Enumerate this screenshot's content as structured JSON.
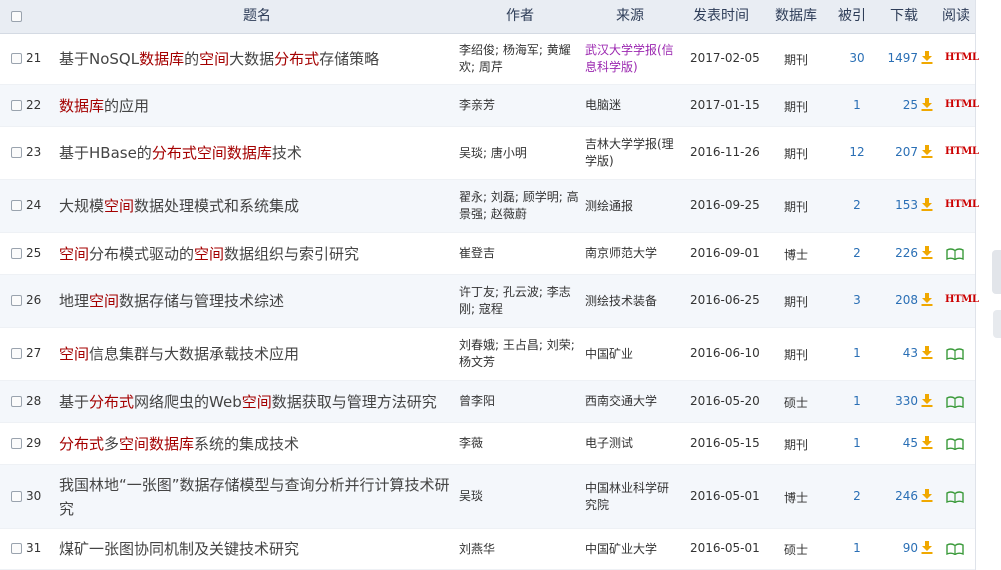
{
  "header": {
    "title": "题名",
    "author": "作者",
    "source": "来源",
    "date": "发表时间",
    "database": "数据库",
    "cited": "被引",
    "downloads": "下载",
    "read": "阅读"
  },
  "rows": [
    {
      "num": "21",
      "title": [
        [
          "基于NoSQL",
          0
        ],
        [
          "数据库",
          1
        ],
        [
          "的",
          0
        ],
        [
          "空间",
          1
        ],
        [
          "大数据",
          0
        ],
        [
          "分布式",
          1
        ],
        [
          "存储策略",
          0
        ]
      ],
      "author": "李绍俊; 杨海军; 黄耀欢; 周芹",
      "source": "武汉大学学报(信息科学版)",
      "source_color": "purple",
      "date": "2017-02-05",
      "db": "期刊",
      "cited": "30",
      "downloads": "1497",
      "read": "html"
    },
    {
      "num": "22",
      "title": [
        [
          "数据库",
          1
        ],
        [
          "的应用",
          0
        ]
      ],
      "author": "李亲芳",
      "source": "电脑迷",
      "source_color": "",
      "date": "2017-01-15",
      "db": "期刊",
      "cited": "1",
      "downloads": "25",
      "read": "html"
    },
    {
      "num": "23",
      "title": [
        [
          "基于HBase的",
          0
        ],
        [
          "分布式空间数据库",
          1
        ],
        [
          "技术",
          0
        ]
      ],
      "author": "吴琰; 唐小明",
      "source": "吉林大学学报(理学版)",
      "source_color": "",
      "date": "2016-11-26",
      "db": "期刊",
      "cited": "12",
      "downloads": "207",
      "read": "html"
    },
    {
      "num": "24",
      "title": [
        [
          "大规模",
          0
        ],
        [
          "空间",
          1
        ],
        [
          "数据处理模式和系统集成",
          0
        ]
      ],
      "author": "翟永; 刘磊; 顾学明; 高景强; 赵薇蔚",
      "source": "测绘通报",
      "source_color": "",
      "date": "2016-09-25",
      "db": "期刊",
      "cited": "2",
      "downloads": "153",
      "read": "html"
    },
    {
      "num": "25",
      "title": [
        [
          "空间",
          1
        ],
        [
          "分布模式驱动的",
          0
        ],
        [
          "空间",
          1
        ],
        [
          "数据组织与索引研究",
          0
        ]
      ],
      "author": "崔登吉",
      "source": "南京师范大学",
      "source_color": "",
      "date": "2016-09-01",
      "db": "博士",
      "cited": "2",
      "downloads": "226",
      "read": "book"
    },
    {
      "num": "26",
      "title": [
        [
          "地理",
          0
        ],
        [
          "空间",
          1
        ],
        [
          "数据存储与管理技术综述",
          0
        ]
      ],
      "author": "许丁友; 孔云波; 李志刚; 寇程",
      "source": "测绘技术装备",
      "source_color": "",
      "date": "2016-06-25",
      "db": "期刊",
      "cited": "3",
      "downloads": "208",
      "read": "html"
    },
    {
      "num": "27",
      "title": [
        [
          "空间",
          1
        ],
        [
          "信息集群与大数据承载技术应用",
          0
        ]
      ],
      "author": "刘春娥; 王占昌; 刘荣; 杨文芳",
      "source": "中国矿业",
      "source_color": "",
      "date": "2016-06-10",
      "db": "期刊",
      "cited": "1",
      "downloads": "43",
      "read": "book"
    },
    {
      "num": "28",
      "title": [
        [
          "基于",
          0
        ],
        [
          "分布式",
          1
        ],
        [
          "网络爬虫的Web",
          0
        ],
        [
          "空间",
          1
        ],
        [
          "数据获取与管理方法研究",
          0
        ]
      ],
      "author": "曾李阳",
      "source": "西南交通大学",
      "source_color": "",
      "date": "2016-05-20",
      "db": "硕士",
      "cited": "1",
      "downloads": "330",
      "read": "book"
    },
    {
      "num": "29",
      "title": [
        [
          "分布式",
          1
        ],
        [
          "多",
          0
        ],
        [
          "空间数据库",
          1
        ],
        [
          "系统的集成技术",
          0
        ]
      ],
      "author": "李薇",
      "source": "电子测试",
      "source_color": "",
      "date": "2016-05-15",
      "db": "期刊",
      "cited": "1",
      "downloads": "45",
      "read": "book"
    },
    {
      "num": "30",
      "title": [
        [
          "我国林地“一张图”数据存储模型与查询分析并行计算技术研究",
          0
        ]
      ],
      "author": "吴琰",
      "source": "中国林业科学研究院",
      "source_color": "",
      "date": "2016-05-01",
      "db": "博士",
      "cited": "2",
      "downloads": "246",
      "read": "book"
    },
    {
      "num": "31",
      "title": [
        [
          "煤矿一张图协同机制及关键技术研究",
          0
        ]
      ],
      "author": "刘燕华",
      "source": "中国矿业大学",
      "source_color": "",
      "date": "2016-05-01",
      "db": "硕士",
      "cited": "1",
      "downloads": "90",
      "read": "book"
    }
  ],
  "icons": {
    "download": "download-icon",
    "html": "html-icon",
    "read": "book-read-icon"
  },
  "html_label": "HTML",
  "colors": {
    "highlight": "#a40000",
    "link": "#2a6fb5",
    "html_red": "#cc0000",
    "source_purple": "#9b27b0",
    "header_bg": "#e9edf3",
    "alt_row_bg": "#f4f7fb"
  }
}
